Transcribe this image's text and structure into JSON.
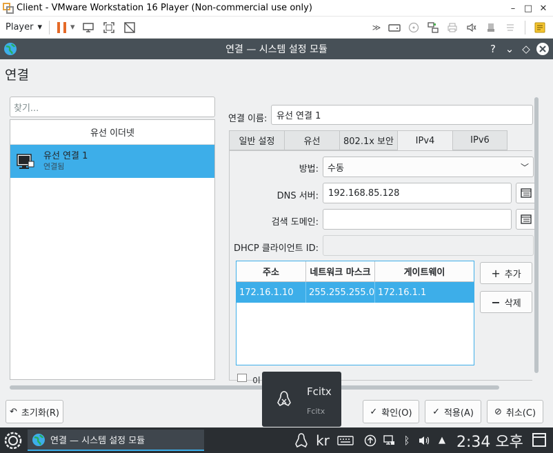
{
  "vm_window": {
    "title": "Client - VMware Workstation 16 Player (Non-commercial use only)",
    "player_menu": "Player"
  },
  "kde_window": {
    "title": "연결 — 시스템 설정 모듈"
  },
  "page": {
    "heading": "연결",
    "search_placeholder": "찾기..."
  },
  "connections": {
    "group": "유선 이더넷",
    "items": [
      {
        "name": "유선 연결 1",
        "status": "연결됨"
      }
    ]
  },
  "editor": {
    "name_label": "연결 이름:",
    "name_value": "유선 연결 1",
    "tabs": [
      {
        "label": "일반 설정"
      },
      {
        "label": "유선"
      },
      {
        "label": "802.1x 보안"
      },
      {
        "label": "IPv4"
      },
      {
        "label": "IPv6"
      }
    ],
    "active_tab": "IPv4",
    "method_label": "방법:",
    "method_value": "수동",
    "dns_label": "DNS 서버:",
    "dns_value": "192.168.85.128",
    "search_domains_label": "검색 도메인:",
    "search_domains_value": "",
    "dhcp_client_id_label": "DHCP 클라이언트 ID:",
    "dhcp_client_id_value": "",
    "addresses": {
      "columns": [
        "주소",
        "네트워크 마스크",
        "게이트웨이"
      ],
      "rows": [
        [
          "172.16.1.10",
          "255.255.255.0",
          "172.16.1.1"
        ]
      ]
    },
    "add_button": "추가",
    "remove_button": "삭제",
    "partial_checkbox_label": "이"
  },
  "buttons": {
    "reset": "초기화(R)",
    "ok": "확인(O)",
    "apply": "적용(A)",
    "cancel": "취소(C)"
  },
  "fcitx_popup": {
    "title": "Fcitx",
    "subtitle": "Fcitx"
  },
  "taskbar": {
    "task_title": "연결 — 시스템 설정 모듈",
    "input_method": "kr",
    "clock": "2:34 오후"
  },
  "colors": {
    "accent": "#3daee9",
    "titlebar": "#475057",
    "taskbar": "#2a2e32",
    "window_bg": "#eff0f1"
  }
}
